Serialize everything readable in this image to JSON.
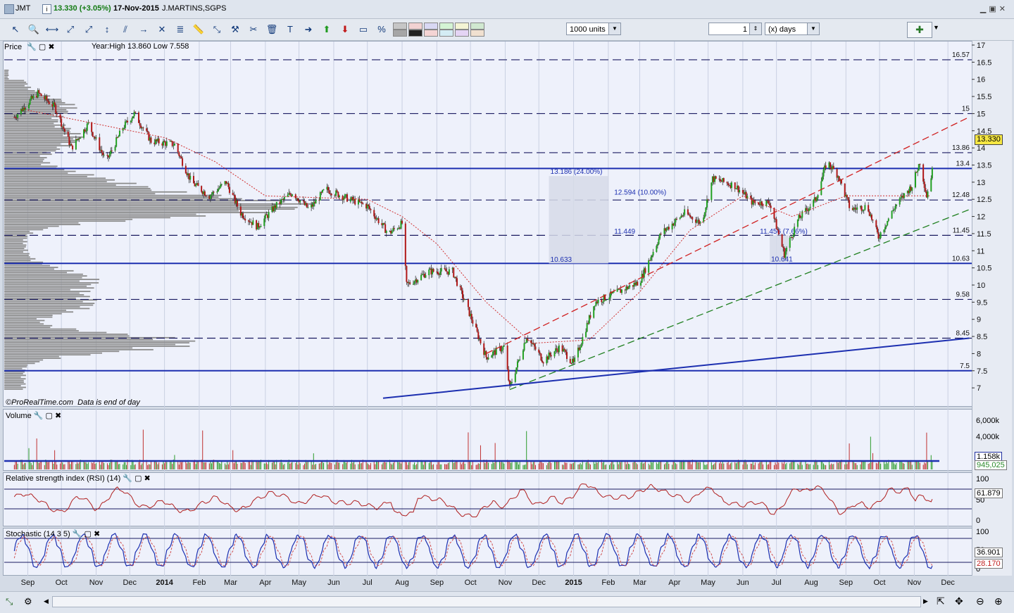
{
  "window": {
    "ticker": "JMT",
    "quote": "13.330 (+3.05%)",
    "date": "17-Nov-2015",
    "name": "J.MARTINS,SGPS",
    "colors": {
      "up": "#22a022",
      "down": "#b01818",
      "accent": "#1c2fb0"
    }
  },
  "toolbar": {
    "units_value": "1000 units",
    "period_value": "1",
    "period_unit": "(x) days",
    "icons": [
      "cursor-icon",
      "zoom-icon",
      "horizontal-line-icon",
      "trendline-icon",
      "ray-icon",
      "vertical-line-icon",
      "channel-icon",
      "horizontal-ray-icon",
      "cross-icon",
      "fibonacci-icon",
      "ruler-icon",
      "arrows-icon",
      "tools-icon",
      "scissors-icon",
      "delete-icon",
      "text-icon",
      "arrow-right-icon",
      "arrow-up-icon",
      "arrow-down-icon",
      "shape-icon",
      "percent-icon"
    ]
  },
  "price_panel": {
    "label": "Price",
    "info": "Year:High 13.860 Low 7.558",
    "footer": "©ProRealTime.com  Data is end of day",
    "current_price": "13.330"
  },
  "volume_panel": {
    "label": "Volume",
    "ma_value": "1.158k",
    "value": "945,025",
    "ticks": [
      "6,000k",
      "4,000k"
    ]
  },
  "rsi_panel": {
    "label": "Relative strength index (RSI) (14)",
    "value": "61.879",
    "ticks": [
      "100",
      "50",
      "0"
    ]
  },
  "stoch_panel": {
    "label": "Stochastic (14 3 5)",
    "k_value": "36.901",
    "d_value": "28.170",
    "ticks": [
      "100",
      "50",
      "0"
    ]
  },
  "chart_data": {
    "type": "candlestick",
    "title": "JMT",
    "x_labels": [
      "Sep",
      "Oct",
      "Nov",
      "Dec",
      "2014",
      "Feb",
      "Mar",
      "Apr",
      "May",
      "Jun",
      "Jul",
      "Aug",
      "Sep",
      "Oct",
      "Nov",
      "Dec",
      "2015",
      "Feb",
      "Mar",
      "Apr",
      "May",
      "Jun",
      "Jul",
      "Aug",
      "Sep",
      "Oct",
      "Nov",
      "Dec"
    ],
    "y_ticks": [
      "17",
      "16.5",
      "16",
      "15.5",
      "15",
      "14.5",
      "14",
      "13.5",
      "13",
      "12.5",
      "12",
      "11.5",
      "11",
      "10.5",
      "10",
      "9.5",
      "9",
      "8.5",
      "8",
      "7.5",
      "7"
    ],
    "ylim": [
      6.8,
      17.1
    ],
    "horizontal_levels": [
      {
        "label": "16.57",
        "value": 16.57,
        "style": "dashed"
      },
      {
        "label": "15",
        "value": 15.0,
        "style": "dashed"
      },
      {
        "label": "13.86",
        "value": 13.86,
        "style": "dashed"
      },
      {
        "label": "13.4",
        "value": 13.4,
        "style": "solid"
      },
      {
        "label": "12.48",
        "value": 12.48,
        "style": "dashed"
      },
      {
        "label": "11.45",
        "value": 11.45,
        "style": "dashed"
      },
      {
        "label": "10.63",
        "value": 10.63,
        "style": "solid"
      },
      {
        "label": "9.58",
        "value": 9.58,
        "style": "dashed"
      },
      {
        "label": "8.45",
        "value": 8.45,
        "style": "dashed"
      },
      {
        "label": "7.5",
        "value": 7.5,
        "style": "solid"
      }
    ],
    "annotations": [
      "13.186 (24.00%)",
      "12.594 (10.00%)",
      "11.449",
      "10.633",
      "11.456 (7.66%)",
      "10.641"
    ],
    "price_path": [
      {
        "x": "2013-08-20",
        "y": 14.9
      },
      {
        "x": "2013-09-10",
        "y": 15.6
      },
      {
        "x": "2013-09-25",
        "y": 15.2
      },
      {
        "x": "2013-10-10",
        "y": 14.0
      },
      {
        "x": "2013-10-25",
        "y": 14.7
      },
      {
        "x": "2013-11-10",
        "y": 13.6
      },
      {
        "x": "2013-11-25",
        "y": 14.6
      },
      {
        "x": "2013-12-05",
        "y": 15.0
      },
      {
        "x": "2013-12-20",
        "y": 14.2
      },
      {
        "x": "2014-01-10",
        "y": 14.1
      },
      {
        "x": "2014-01-25",
        "y": 13.0
      },
      {
        "x": "2014-02-10",
        "y": 12.6
      },
      {
        "x": "2014-02-25",
        "y": 13.0
      },
      {
        "x": "2014-03-10",
        "y": 12.1
      },
      {
        "x": "2014-03-25",
        "y": 11.7
      },
      {
        "x": "2014-04-10",
        "y": 12.3
      },
      {
        "x": "2014-04-25",
        "y": 12.7
      },
      {
        "x": "2014-05-10",
        "y": 12.2
      },
      {
        "x": "2014-05-25",
        "y": 12.8
      },
      {
        "x": "2014-06-15",
        "y": 12.5
      },
      {
        "x": "2014-07-01",
        "y": 12.3
      },
      {
        "x": "2014-07-20",
        "y": 11.5
      },
      {
        "x": "2014-08-01",
        "y": 11.8
      },
      {
        "x": "2014-08-05",
        "y": 10.0
      },
      {
        "x": "2014-08-25",
        "y": 10.4
      },
      {
        "x": "2014-09-15",
        "y": 10.4
      },
      {
        "x": "2014-10-01",
        "y": 9.1
      },
      {
        "x": "2014-10-15",
        "y": 7.9
      },
      {
        "x": "2014-10-31",
        "y": 8.2
      },
      {
        "x": "2014-11-05",
        "y": 7.0
      },
      {
        "x": "2014-11-20",
        "y": 8.5
      },
      {
        "x": "2014-12-05",
        "y": 7.8
      },
      {
        "x": "2014-12-20",
        "y": 8.2
      },
      {
        "x": "2015-01-01",
        "y": 7.7
      },
      {
        "x": "2015-01-20",
        "y": 9.5
      },
      {
        "x": "2015-02-10",
        "y": 9.8
      },
      {
        "x": "2015-03-01",
        "y": 10.1
      },
      {
        "x": "2015-03-20",
        "y": 11.5
      },
      {
        "x": "2015-04-10",
        "y": 12.1
      },
      {
        "x": "2015-04-25",
        "y": 11.8
      },
      {
        "x": "2015-05-05",
        "y": 13.1
      },
      {
        "x": "2015-05-25",
        "y": 12.9
      },
      {
        "x": "2015-06-10",
        "y": 12.4
      },
      {
        "x": "2015-06-25",
        "y": 12.4
      },
      {
        "x": "2015-07-08",
        "y": 10.9
      },
      {
        "x": "2015-07-20",
        "y": 11.9
      },
      {
        "x": "2015-08-05",
        "y": 12.5
      },
      {
        "x": "2015-08-15",
        "y": 13.6
      },
      {
        "x": "2015-08-25",
        "y": 13.2
      },
      {
        "x": "2015-09-05",
        "y": 12.2
      },
      {
        "x": "2015-09-20",
        "y": 12.3
      },
      {
        "x": "2015-09-30",
        "y": 11.4
      },
      {
        "x": "2015-10-15",
        "y": 12.3
      },
      {
        "x": "2015-10-30",
        "y": 12.9
      },
      {
        "x": "2015-11-06",
        "y": 13.6
      },
      {
        "x": "2015-11-12",
        "y": 12.6
      },
      {
        "x": "2015-11-17",
        "y": 13.33
      }
    ],
    "moving_average_path": [
      {
        "x": "2013-09-01",
        "y": 15.1
      },
      {
        "x": "2013-11-01",
        "y": 14.7
      },
      {
        "x": "2014-01-01",
        "y": 14.3
      },
      {
        "x": "2014-02-15",
        "y": 13.6
      },
      {
        "x": "2014-04-01",
        "y": 12.6
      },
      {
        "x": "2014-07-01",
        "y": 12.5
      },
      {
        "x": "2014-08-01",
        "y": 12.0
      },
      {
        "x": "2014-09-01",
        "y": 11.2
      },
      {
        "x": "2014-10-15",
        "y": 9.5
      },
      {
        "x": "2014-11-25",
        "y": 8.3
      },
      {
        "x": "2015-01-15",
        "y": 8.4
      },
      {
        "x": "2015-03-01",
        "y": 9.8
      },
      {
        "x": "2015-04-15",
        "y": 11.6
      },
      {
        "x": "2015-06-01",
        "y": 12.6
      },
      {
        "x": "2015-07-15",
        "y": 12.0
      },
      {
        "x": "2015-09-01",
        "y": 12.6
      },
      {
        "x": "2015-11-15",
        "y": 12.6
      }
    ],
    "trendlines": [
      {
        "color": "#d02020",
        "from": {
          "x": "2014-10-15",
          "y": 8.0
        },
        "to": {
          "x": "2015-12-20",
          "y": 14.9
        }
      },
      {
        "color": "#208020",
        "from": {
          "x": "2014-11-05",
          "y": 6.95
        },
        "to": {
          "x": "2015-12-20",
          "y": 12.2
        }
      },
      {
        "color": "#1c2fb0",
        "from": {
          "x": "2014-07-15",
          "y": 6.7
        },
        "to": {
          "x": "2015-12-20",
          "y": 8.45
        }
      }
    ]
  }
}
